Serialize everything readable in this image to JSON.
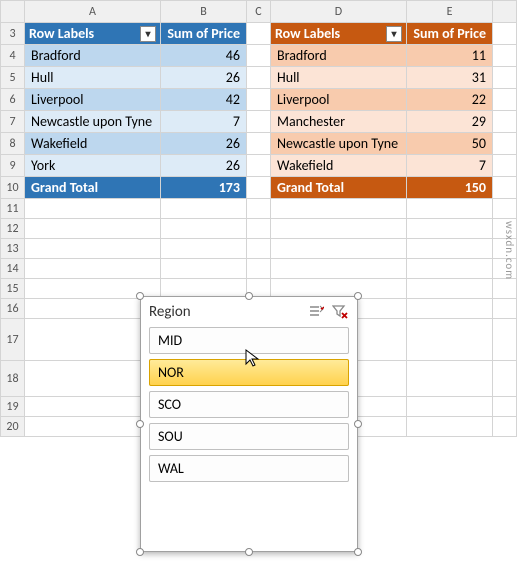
{
  "columns": [
    "",
    "A",
    "B",
    "C",
    "D",
    "E",
    ""
  ],
  "row_numbers": [
    3,
    4,
    5,
    6,
    7,
    8,
    9,
    10,
    11,
    12,
    13,
    14,
    15,
    16,
    17,
    18,
    19,
    20
  ],
  "pivot1": {
    "theme": "blue",
    "row_labels_header": "Row Labels",
    "value_header": "Sum of Price",
    "rows": [
      {
        "label": "Bradford",
        "value": 46
      },
      {
        "label": "Hull",
        "value": 26
      },
      {
        "label": "Liverpool",
        "value": 42
      },
      {
        "label": "Newcastle upon Tyne",
        "value": 7
      },
      {
        "label": "Wakefield",
        "value": 26
      },
      {
        "label": "York",
        "value": 26
      }
    ],
    "total_label": "Grand Total",
    "total_value": 173
  },
  "pivot2": {
    "theme": "brown",
    "row_labels_header": "Row Labels",
    "value_header": "Sum of Price",
    "rows": [
      {
        "label": "Bradford",
        "value": 11
      },
      {
        "label": "Hull",
        "value": 31
      },
      {
        "label": "Liverpool",
        "value": 22
      },
      {
        "label": "Manchester",
        "value": 29
      },
      {
        "label": "Newcastle upon Tyne",
        "value": 50
      },
      {
        "label": "Wakefield",
        "value": 7
      }
    ],
    "total_label": "Grand Total",
    "total_value": 150
  },
  "slicer": {
    "title": "Region",
    "items": [
      "MID",
      "NOR",
      "SCO",
      "SOU",
      "WAL"
    ],
    "selected": "NOR"
  },
  "watermark": "wsxdn.com"
}
